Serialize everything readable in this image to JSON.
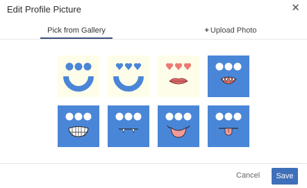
{
  "dialog": {
    "title": "Edit Profile Picture",
    "close_glyph": "✕"
  },
  "tabs": [
    {
      "label": "Pick from Gallery",
      "active": true
    },
    {
      "label": "Upload Photo",
      "active": false,
      "icon": "plus-icon"
    }
  ],
  "gallery": {
    "avatars": [
      {
        "name": "smile-dots-light",
        "background": "light"
      },
      {
        "name": "smile-hearts-light",
        "background": "light"
      },
      {
        "name": "lips-hearts-light",
        "background": "light"
      },
      {
        "name": "grimace-teeth-blue",
        "background": "blue"
      },
      {
        "name": "grin-teeth-blue",
        "background": "blue"
      },
      {
        "name": "fangs-blue",
        "background": "blue"
      },
      {
        "name": "smirk-blue",
        "background": "blue"
      },
      {
        "name": "tongue-out-blue",
        "background": "blue"
      }
    ],
    "colors": {
      "light": "#fdfde9",
      "blue": "#4a86d8",
      "face_blue": "#4a86d8",
      "white": "#ffffff",
      "heart_pink": "#ec7a73",
      "lips": "#e06b69",
      "tongue": "#f29a9a"
    }
  },
  "footer": {
    "cancel_label": "Cancel",
    "save_label": "Save"
  }
}
